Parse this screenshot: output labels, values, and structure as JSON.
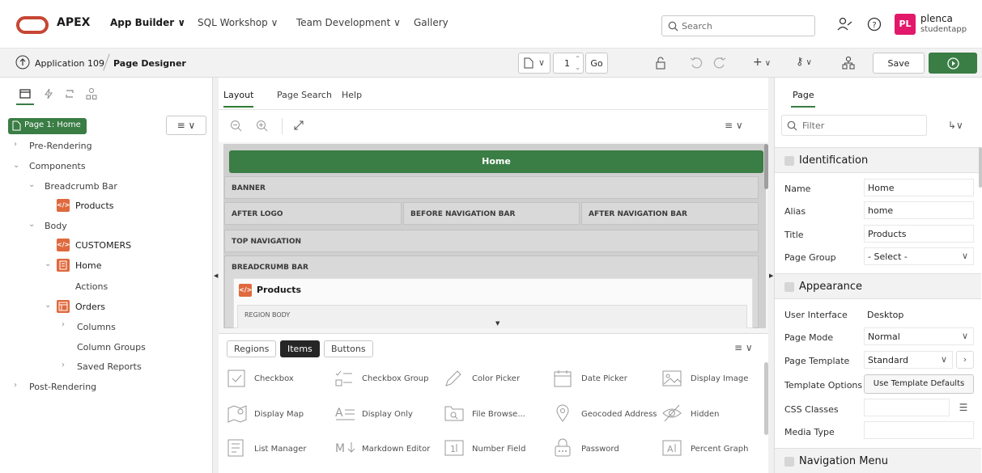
{
  "topbar": {
    "brand": "APEX",
    "nav": [
      {
        "label": "App Builder ∨"
      },
      {
        "label": "SQL Workshop ∨"
      },
      {
        "label": "Team Development ∨"
      },
      {
        "label": "Gallery"
      }
    ],
    "search_placeholder": "Search",
    "user": {
      "initials": "PL",
      "name": "plenca",
      "workspace": "studentapp"
    },
    "avatar_color": "#e2186b"
  },
  "toolbar": {
    "breadcrumb_app": "Application 109",
    "breadcrumb_page": "Page Designer",
    "page_number": "1",
    "go_label": "Go",
    "save_label": "Save"
  },
  "left": {
    "page_label": "Page 1: Home",
    "tree": [
      {
        "label": "Pre-Rendering"
      },
      {
        "label": "Components"
      },
      {
        "label": "Breadcrumb Bar"
      },
      {
        "label": "Products"
      },
      {
        "label": "Body"
      },
      {
        "label": "CUSTOMERS"
      },
      {
        "label": "Home"
      },
      {
        "label": "Actions"
      },
      {
        "label": "Orders"
      },
      {
        "label": "Columns"
      },
      {
        "label": "Column Groups"
      },
      {
        "label": "Saved Reports"
      },
      {
        "label": "Post-Rendering"
      }
    ]
  },
  "center": {
    "tabs": [
      {
        "label": "Layout"
      },
      {
        "label": "Page Search"
      },
      {
        "label": "Help"
      }
    ],
    "home_title": "Home",
    "slots": {
      "banner": "BANNER",
      "after_logo": "AFTER LOGO",
      "before_nav": "BEFORE NAVIGATION BAR",
      "after_nav": "AFTER NAVIGATION BAR",
      "top_nav": "TOP NAVIGATION",
      "breadcrumb": "BREADCRUMB BAR",
      "region_title": "Products",
      "region_body": "REGION BODY"
    },
    "gallery_tabs": [
      {
        "label": "Regions"
      },
      {
        "label": "Items"
      },
      {
        "label": "Buttons"
      }
    ],
    "gallery_items": [
      {
        "label": "Checkbox"
      },
      {
        "label": "Checkbox Group"
      },
      {
        "label": "Color Picker"
      },
      {
        "label": "Date Picker"
      },
      {
        "label": "Display Image"
      },
      {
        "label": "Display Map"
      },
      {
        "label": "Display Only"
      },
      {
        "label": "File Browse..."
      },
      {
        "label": "Geocoded Address"
      },
      {
        "label": "Hidden"
      },
      {
        "label": "List Manager"
      },
      {
        "label": "Markdown Editor"
      },
      {
        "label": "Number Field"
      },
      {
        "label": "Password"
      },
      {
        "label": "Percent Graph"
      }
    ]
  },
  "right": {
    "tab": "Page",
    "filter_placeholder": "Filter",
    "identification": {
      "title": "Identification",
      "name_label": "Name",
      "name_value": "Home",
      "alias_label": "Alias",
      "alias_value": "home",
      "title_label": "Title",
      "title_value": "Products",
      "group_label": "Page Group",
      "group_value": "- Select -"
    },
    "appearance": {
      "title": "Appearance",
      "ui_label": "User Interface",
      "ui_value": "Desktop",
      "mode_label": "Page Mode",
      "mode_value": "Normal",
      "template_label": "Page Template",
      "template_value": "Standard",
      "options_label": "Template Options",
      "options_button": "Use Template Defaults",
      "css_label": "CSS Classes",
      "media_label": "Media Type"
    },
    "navigation_menu": "Navigation Menu"
  },
  "colors": {
    "accent": "#3a7d45",
    "brand_red": "#c74634"
  }
}
